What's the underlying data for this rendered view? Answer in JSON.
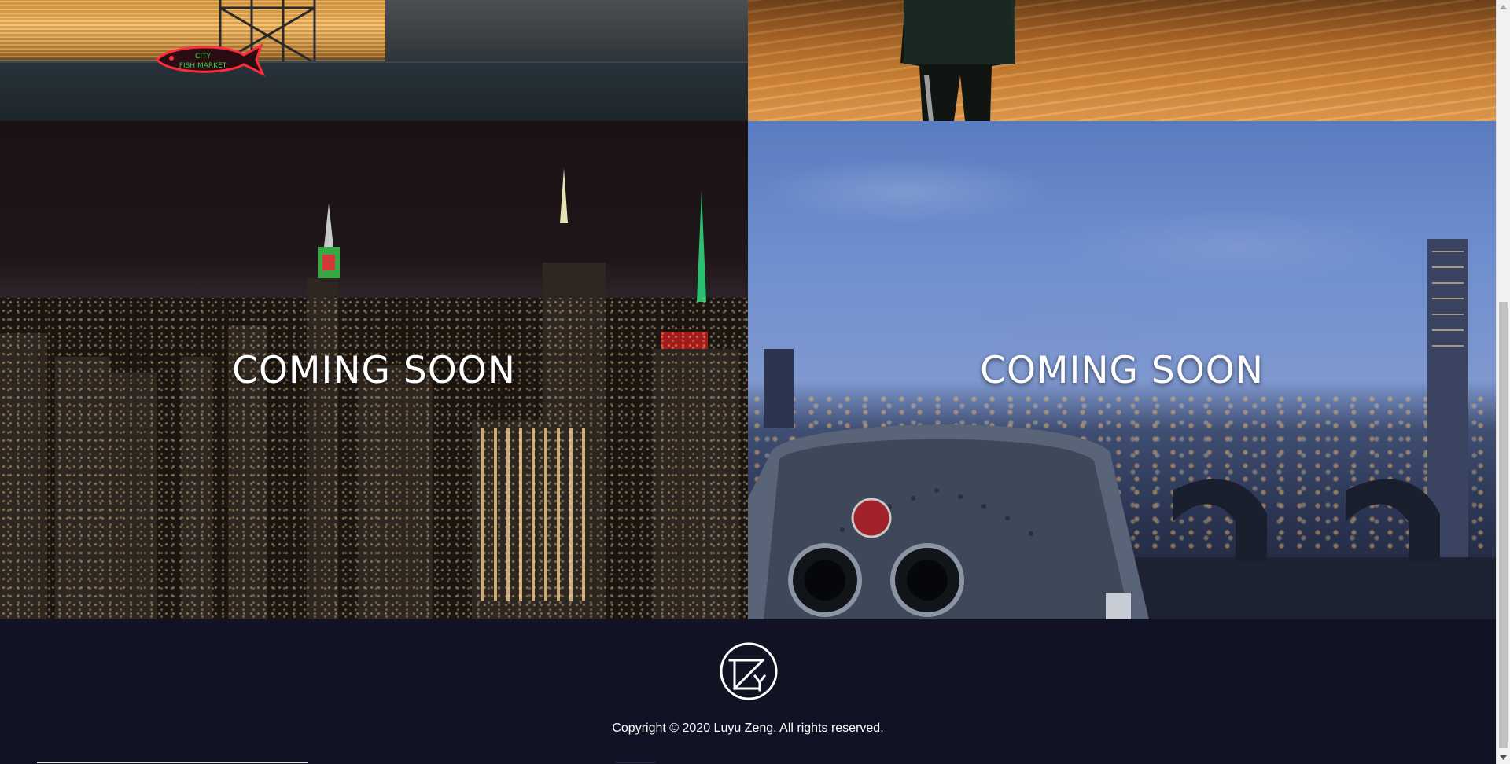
{
  "gallery": {
    "tiles": [
      {
        "name": "fish-market",
        "caption": ""
      },
      {
        "name": "basketball-court",
        "caption": ""
      },
      {
        "name": "city-night",
        "caption": "COMING SOON"
      },
      {
        "name": "city-viewer",
        "caption": "COMING SOON"
      }
    ],
    "fish_sign_text": "CITY FISH MARKET"
  },
  "footer": {
    "logo_icon": "lz-monogram-icon",
    "copyright": "Copyright © 2020 Luyu Zeng. All rights reserved."
  },
  "colors": {
    "footer_bg": "#121225",
    "caption_text": "#ffffff",
    "scrollbar_track": "#f1f1f1",
    "scrollbar_thumb": "#c1c1c1"
  }
}
